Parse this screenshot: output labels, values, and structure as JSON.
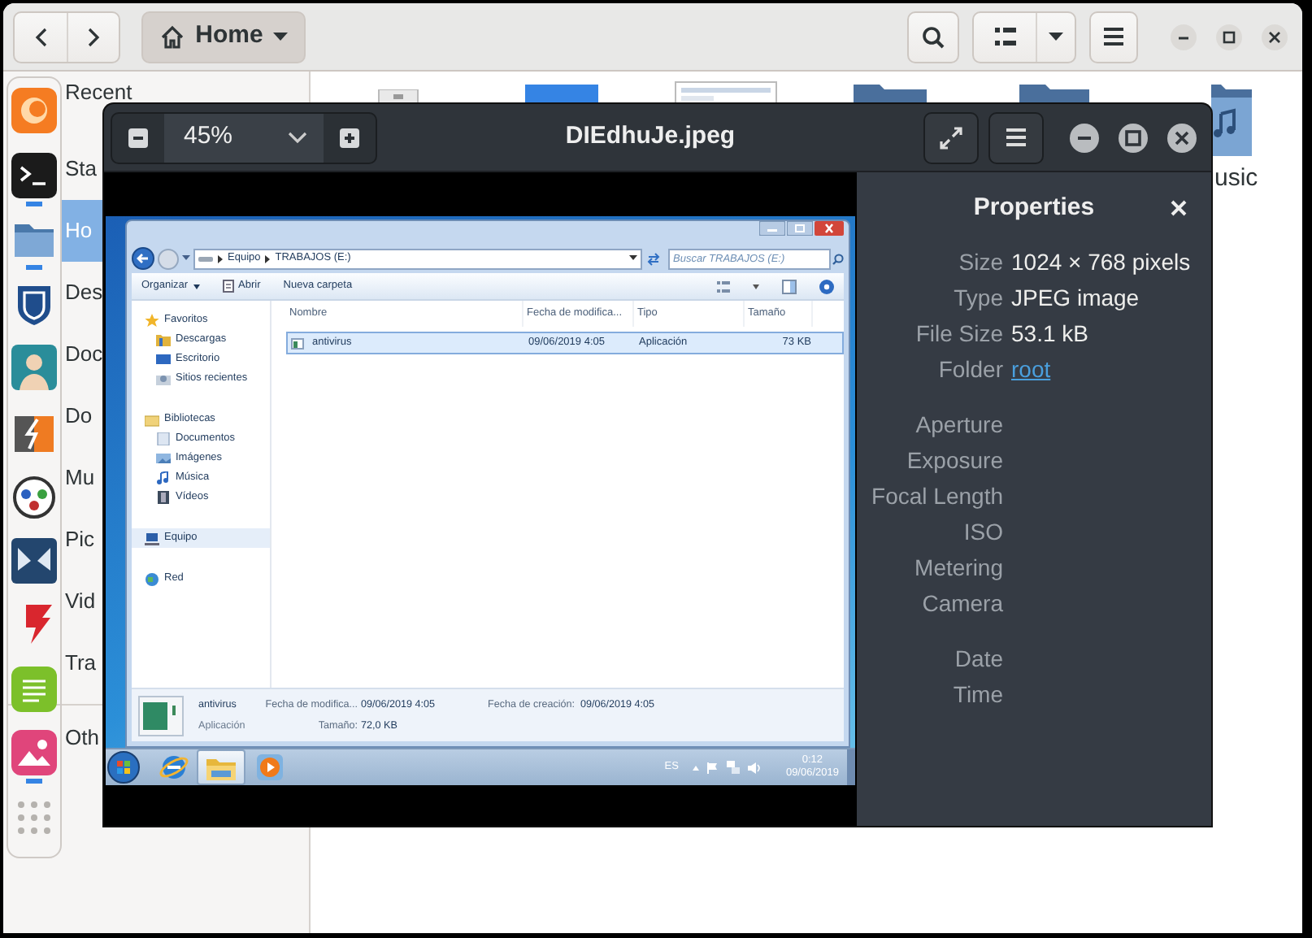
{
  "file_manager": {
    "location": "Home",
    "places": [
      {
        "label": "Recent",
        "selected": false
      },
      {
        "label": "Sta",
        "selected": false
      },
      {
        "label": "Ho",
        "selected": true
      },
      {
        "label": "Des",
        "selected": false
      },
      {
        "label": "Doc",
        "selected": false
      },
      {
        "label": "Do",
        "selected": false
      },
      {
        "label": "Mu",
        "selected": false
      },
      {
        "label": "Pic",
        "selected": false
      },
      {
        "label": "Vid",
        "selected": false
      },
      {
        "label": "Tra",
        "selected": false
      }
    ],
    "other": [
      {
        "label": "Oth",
        "selected": false
      }
    ],
    "partial_item_label": "usic"
  },
  "dock": {
    "apps": [
      {
        "running": false
      },
      {
        "running": true
      },
      {
        "running": true
      },
      {
        "running": false
      },
      {
        "running": false
      },
      {
        "running": false
      },
      {
        "running": false
      },
      {
        "running": false
      },
      {
        "running": false
      },
      {
        "running": false
      },
      {
        "running": true
      },
      {
        "running": false
      }
    ]
  },
  "viewer": {
    "zoom": "45%",
    "title": "DIEdhuJe.jpeg",
    "image": {
      "address": [
        "Equipo",
        "TRABAJOS (E:)"
      ],
      "search": {
        "placeholder": "Buscar TRABAJOS (E:)"
      },
      "toolbar": [
        "Organizar",
        "Abrir",
        "Nueva carpeta"
      ],
      "nav": [
        {
          "label": "Favoritos",
          "selected": false,
          "children": [
            {
              "label": "Descargas",
              "selected": false
            },
            {
              "label": "Escritorio",
              "selected": false
            },
            {
              "label": "Sitios recientes",
              "selected": false
            }
          ]
        },
        {
          "label": "Bibliotecas",
          "selected": false,
          "children": [
            {
              "label": "Documentos",
              "selected": false
            },
            {
              "label": "Imágenes",
              "selected": false
            },
            {
              "label": "Música",
              "selected": false
            },
            {
              "label": "Vídeos",
              "selected": false
            }
          ]
        },
        {
          "label": "Equipo",
          "selected": true
        },
        {
          "label": "Red",
          "selected": false
        }
      ],
      "columns": [
        "Nombre",
        "Fecha de modifica...",
        "Tipo",
        "Tamaño"
      ],
      "rows": [
        {
          "cells": [
            "antivirus",
            "09/06/2019 4:05",
            "Aplicación",
            "73 KB"
          ],
          "selected": true
        }
      ],
      "details": {
        "name": "antivirus",
        "type": "Aplicación",
        "fields": [
          {
            "label": "Fecha de modifica...",
            "value": "09/06/2019 4:05"
          },
          {
            "label": "Tamaño:",
            "value": "72,0 KB"
          },
          {
            "label": "Fecha de creación:",
            "value": "09/06/2019 4:05"
          }
        ]
      },
      "taskbar": {
        "language": "ES",
        "time": "0:12",
        "date": "09/06/2019"
      }
    },
    "properties": {
      "title": "Properties",
      "groups": [
        [
          {
            "label": "Size",
            "value": "1024 × 768 pixels",
            "kind": "text"
          },
          {
            "label": "Type",
            "value": "JPEG image",
            "kind": "text"
          },
          {
            "label": "File Size",
            "value": "53.1 kB",
            "kind": "text"
          },
          {
            "label": "Folder",
            "value": "root",
            "kind": "link"
          }
        ],
        [
          {
            "label": "Aperture",
            "kind": "blank"
          },
          {
            "label": "Exposure",
            "kind": "blank"
          },
          {
            "label": "Focal Length",
            "kind": "blank"
          },
          {
            "label": "ISO",
            "kind": "blank"
          },
          {
            "label": "Metering",
            "kind": "blank"
          },
          {
            "label": "Camera",
            "kind": "blank"
          }
        ],
        [
          {
            "label": "Date",
            "kind": "blank"
          },
          {
            "label": "Time",
            "kind": "blank"
          }
        ]
      ]
    }
  }
}
